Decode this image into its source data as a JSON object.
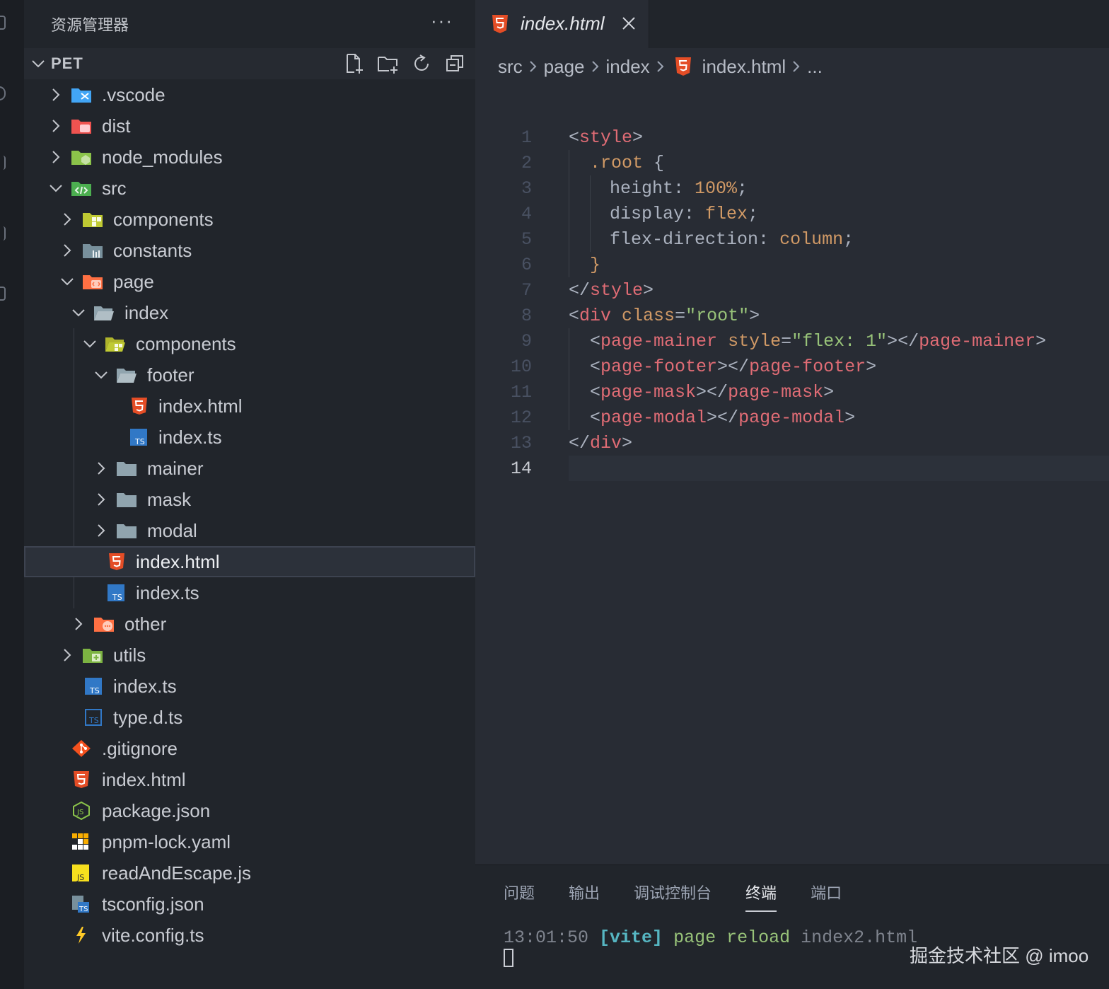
{
  "sidebar": {
    "title": "资源管理器",
    "more": "···",
    "project": "PET",
    "actions": [
      "new-file-icon",
      "new-folder-icon",
      "refresh-icon",
      "collapse-all-icon"
    ],
    "tree": [
      {
        "label": ".vscode",
        "icon": "vscode-folder-icon"
      },
      {
        "label": "dist",
        "icon": "dist-folder-icon"
      },
      {
        "label": "node_modules",
        "icon": "node-folder-icon"
      },
      {
        "label": "src",
        "icon": "src-folder-icon"
      },
      {
        "label": "components",
        "icon": "components-folder-icon"
      },
      {
        "label": "constants",
        "icon": "constants-folder-icon"
      },
      {
        "label": "page",
        "icon": "page-folder-icon"
      },
      {
        "label": "index",
        "icon": "folder-open-icon"
      },
      {
        "label": "components",
        "icon": "components-folder-open-icon"
      },
      {
        "label": "footer",
        "icon": "folder-open-icon"
      },
      {
        "label": "index.html",
        "icon": "html-file-icon"
      },
      {
        "label": "index.ts",
        "icon": "ts-file-icon"
      },
      {
        "label": "mainer",
        "icon": "folder-icon"
      },
      {
        "label": "mask",
        "icon": "folder-icon"
      },
      {
        "label": "modal",
        "icon": "folder-icon"
      },
      {
        "label": "index.html",
        "icon": "html-file-icon"
      },
      {
        "label": "index.ts",
        "icon": "ts-file-icon"
      },
      {
        "label": "other",
        "icon": "other-folder-icon"
      },
      {
        "label": "utils",
        "icon": "utils-folder-icon"
      },
      {
        "label": "index.ts",
        "icon": "ts-file-icon"
      },
      {
        "label": "type.d.ts",
        "icon": "ts-def-file-icon"
      },
      {
        "label": ".gitignore",
        "icon": "git-icon"
      },
      {
        "label": "index.html",
        "icon": "html-file-icon"
      },
      {
        "label": "package.json",
        "icon": "node-js-icon"
      },
      {
        "label": "pnpm-lock.yaml",
        "icon": "pnpm-icon"
      },
      {
        "label": "readAndEscape.js",
        "icon": "js-file-icon"
      },
      {
        "label": "tsconfig.json",
        "icon": "tsconfig-icon"
      },
      {
        "label": "vite.config.ts",
        "icon": "vite-icon"
      }
    ]
  },
  "editor": {
    "tab": {
      "label": "index.html",
      "close": "×"
    },
    "breadcrumb": [
      "src",
      "page",
      "index",
      "index.html",
      "..."
    ],
    "line_numbers": [
      "1",
      "2",
      "3",
      "4",
      "5",
      "6",
      "7",
      "8",
      "9",
      "10",
      "11",
      "12",
      "13",
      "14"
    ],
    "current_line": "14",
    "code": {
      "l1": [
        "<",
        "style",
        ">"
      ],
      "l2": [
        ".root",
        " {"
      ],
      "l3": [
        "height",
        ": ",
        "100%",
        ";"
      ],
      "l4": [
        "display",
        ": ",
        "flex",
        ";"
      ],
      "l5": [
        "flex-direction",
        ": ",
        "column",
        ";"
      ],
      "l6": [
        "}"
      ],
      "l7": [
        "</",
        "style",
        ">"
      ],
      "l8": [
        "<",
        "div",
        " ",
        "class",
        "=",
        "\"root\"",
        ">"
      ],
      "l9": [
        "<",
        "page-mainer",
        " ",
        "style",
        "=",
        "\"flex: 1\"",
        "></",
        "page-mainer",
        ">"
      ],
      "l10": [
        "<",
        "page-footer",
        "></",
        "page-footer",
        ">"
      ],
      "l11": [
        "<",
        "page-mask",
        "></",
        "page-mask",
        ">"
      ],
      "l12": [
        "<",
        "page-modal",
        "></",
        "page-modal",
        ">"
      ],
      "l13": [
        "</",
        "div",
        ">"
      ]
    }
  },
  "panel": {
    "tabs": [
      "问题",
      "输出",
      "调试控制台",
      "终端",
      "端口"
    ],
    "active_tab": "终端",
    "terminal": {
      "time": "13:01:50",
      "tag": "[vite]",
      "message": "page reload",
      "file": "index2.html"
    },
    "watermark": "掘金技术社区 @ imoo"
  },
  "colors": {
    "html": "#e44d26",
    "ts": "#3178c6",
    "folder": "#8b95a5"
  }
}
